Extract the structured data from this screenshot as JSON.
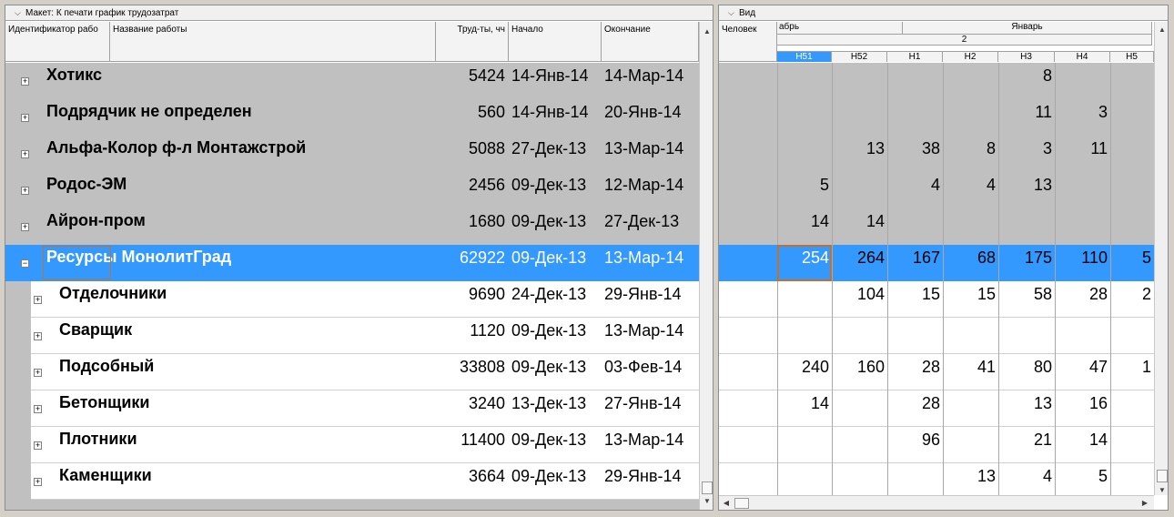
{
  "left_panel": {
    "title": "Макет: К печати график трудозатрат",
    "columns": {
      "id": "Идентификатор рабо",
      "name": "Название работы",
      "labor": "Труд-ты, чч",
      "start": "Начало",
      "finish": "Окончание"
    },
    "rows": [
      {
        "name": "Хотикс",
        "labor": "5424",
        "start": "14-Янв-14",
        "finish": "14-Мар-14",
        "expander": "+"
      },
      {
        "name": "Подрядчик не определен",
        "labor": "560",
        "start": "14-Янв-14",
        "finish": "20-Янв-14",
        "expander": "+"
      },
      {
        "name": "Альфа-Колор ф-л Монтажстрой",
        "labor": "5088",
        "start": "27-Дек-13",
        "finish": "13-Мар-14",
        "expander": "+"
      },
      {
        "name": "Родос-ЭМ",
        "labor": "2456",
        "start": "09-Дек-13",
        "finish": "12-Мар-14",
        "expander": "+"
      },
      {
        "name": "Айрон-пром",
        "labor": "1680",
        "start": "09-Дек-13",
        "finish": "27-Дек-13",
        "expander": "+"
      },
      {
        "name": "Ресурсы МонолитГрад",
        "labor": "62922",
        "start": "09-Дек-13",
        "finish": "13-Мар-14",
        "expander": "−"
      },
      {
        "name": "Отделочники",
        "labor": "9690",
        "start": "24-Дек-13",
        "finish": "29-Янв-14",
        "expander": "+"
      },
      {
        "name": "Сварщик",
        "labor": "1120",
        "start": "09-Дек-13",
        "finish": "13-Мар-14",
        "expander": "+"
      },
      {
        "name": "Подсобный",
        "labor": "33808",
        "start": "09-Дек-13",
        "finish": "03-Фев-14",
        "expander": "+"
      },
      {
        "name": "Бетонщики",
        "labor": "3240",
        "start": "13-Дек-13",
        "finish": "27-Янв-14",
        "expander": "+"
      },
      {
        "name": "Плотники",
        "labor": "11400",
        "start": "09-Дек-13",
        "finish": "13-Мар-14",
        "expander": "+"
      },
      {
        "name": "Каменщики",
        "labor": "3664",
        "start": "09-Дек-13",
        "finish": "29-Янв-14",
        "expander": "+"
      }
    ]
  },
  "right_panel": {
    "title": "Вид",
    "people_label": "Человек",
    "month_prev": "абрь",
    "month_next": "Январь",
    "month_index": "2",
    "weeks": [
      "Н51",
      "Н52",
      "Н1",
      "Н2",
      "Н3",
      "Н4",
      "Н5"
    ],
    "rows": [
      [
        "",
        "",
        "",
        "",
        "8",
        "",
        ""
      ],
      [
        "",
        "",
        "",
        "",
        "11",
        "3",
        ""
      ],
      [
        "",
        "13",
        "38",
        "8",
        "3",
        "11",
        ""
      ],
      [
        "5",
        "",
        "4",
        "4",
        "13",
        "",
        ""
      ],
      [
        "14",
        "14",
        "",
        "",
        "",
        "",
        ""
      ],
      [
        "254",
        "264",
        "167",
        "68",
        "175",
        "110",
        "5"
      ],
      [
        "",
        "104",
        "15",
        "15",
        "58",
        "28",
        "2"
      ],
      [
        "",
        "",
        "",
        "",
        "",
        "",
        ""
      ],
      [
        "240",
        "160",
        "28",
        "41",
        "80",
        "47",
        "1"
      ],
      [
        "14",
        "",
        "28",
        "",
        "13",
        "16",
        ""
      ],
      [
        "",
        "",
        "96",
        "",
        "21",
        "14",
        ""
      ],
      [
        "",
        "",
        "",
        "13",
        "4",
        "5",
        ""
      ]
    ]
  },
  "colors": {
    "group_row": "#c0c0c0",
    "selected_row": "#3399ff",
    "selected_week": "#3399ff",
    "focus_border": "#c07030"
  },
  "icons": {
    "collapse": "chevron-down-icon",
    "scroll_up": "arrow-up-icon",
    "scroll_down": "arrow-down-icon",
    "scroll_left": "arrow-left-icon",
    "scroll_right": "arrow-right-icon"
  }
}
